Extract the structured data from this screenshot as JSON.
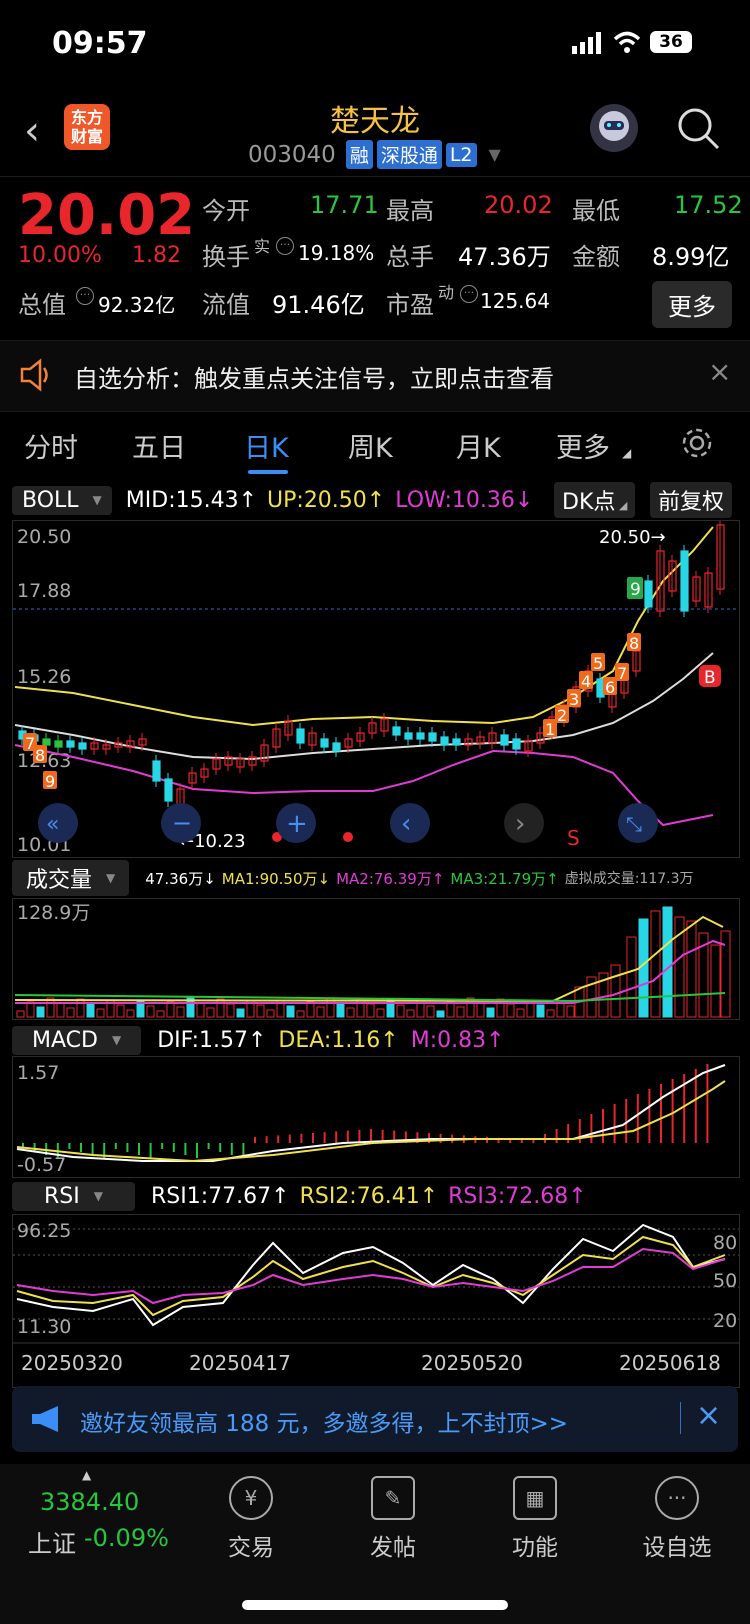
{
  "status_bar": {
    "time": "09:57",
    "battery": "36"
  },
  "header": {
    "logo_text": "东方财富",
    "stock_name": "楚天龙",
    "stock_code": "003040",
    "tags": [
      "融",
      "深股通",
      "L2"
    ]
  },
  "quote": {
    "price": "20.02",
    "change_pct": "10.00%",
    "change_amt": "1.82",
    "open_label": "今开",
    "open": "17.71",
    "high_label": "最高",
    "high": "20.02",
    "low_label": "最低",
    "low": "17.52",
    "turnover_label": "换手",
    "turnover_sup": "实",
    "turnover": "19.18%",
    "volume_label": "总手",
    "volume": "47.36万",
    "amount_label": "金额",
    "amount": "8.99亿",
    "mktcap_label": "总值",
    "mktcap": "92.32亿",
    "float_label": "流值",
    "float_cap": "91.46亿",
    "pe_label": "市盈",
    "pe_sup": "动",
    "pe": "125.64",
    "more_label": "更多"
  },
  "banner": {
    "text": "自选分析：触发重点关注信号，立即点击查看"
  },
  "tabs": {
    "items": [
      "分时",
      "五日",
      "日K",
      "周K",
      "月K",
      "更多"
    ],
    "active": "日K"
  },
  "boll": {
    "selector": "BOLL",
    "mid": "MID:15.43↑",
    "up": "UP:20.50↑",
    "low": "LOW:10.36↓",
    "dk_label": "DK点",
    "adjust_label": "前复权",
    "axis_top": "20.50",
    "axis_mid": "17.88",
    "axis_mid2": "15.26",
    "axis_low": "12.63",
    "axis_bottom": "10.01",
    "high_marker": "20.50→",
    "low_marker": "←10.23",
    "signals_b": "B",
    "signals_s": "S"
  },
  "volume": {
    "selector": "成交量",
    "current": "47.36万↓",
    "ma1": "MA1:90.50万↓",
    "ma2": "MA2:76.39万↑",
    "ma3": "MA3:21.79万↑",
    "virtual": "虚拟成交量:117.3万",
    "axis_top": "128.9万"
  },
  "macd": {
    "selector": "MACD",
    "dif": "DIF:1.57↑",
    "dea": "DEA:1.16↑",
    "m": "M:0.83↑",
    "axis_top": "1.57",
    "axis_bottom": "-0.57"
  },
  "rsi": {
    "selector": "RSI",
    "rsi1": "RSI1:77.67↑",
    "rsi2": "RSI2:76.41↑",
    "rsi3": "RSI3:72.68↑",
    "axis_top": "96.25",
    "axis_bottom": "11.30",
    "levels": [
      "80",
      "50",
      "20"
    ],
    "dates": [
      "20250320",
      "20250417",
      "20250520",
      "20250618"
    ]
  },
  "invite": {
    "text": "邀好友领最高 188 元，多邀多得，上不封顶>>"
  },
  "bottom_nav": {
    "index_value": "3384.40",
    "index_name": "上证",
    "index_change": "-0.09%",
    "items": [
      "交易",
      "发帖",
      "功能",
      "设自选"
    ]
  },
  "colors": {
    "up": "#e8262b",
    "down": "#27c63d",
    "mid_line": "#dddddd",
    "up_line": "#f0e14a",
    "low_line": "#e03bd6",
    "accent": "#2c6fd1"
  }
}
